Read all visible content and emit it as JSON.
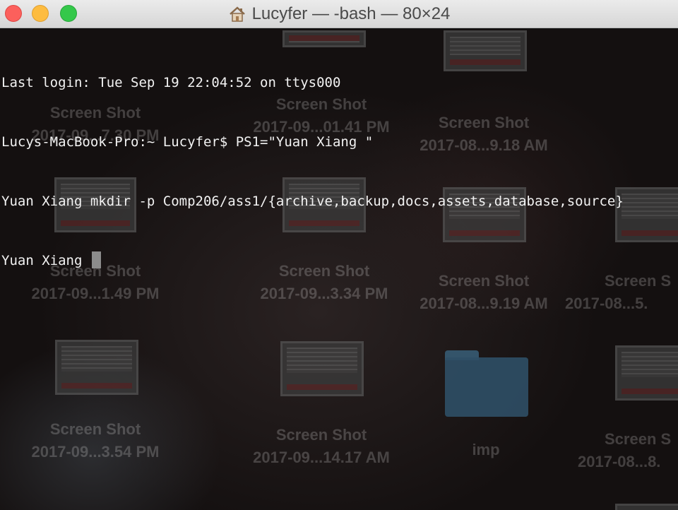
{
  "window": {
    "title": "Lucyfer — -bash — 80×24",
    "title_icon": "home-folder-icon"
  },
  "terminal": {
    "lines": [
      "Last login: Tue Sep 19 22:04:52 on ttys000",
      "Lucys-MacBook-Pro:~ Lucyfer$ PS1=\"Yuan Xiang \"",
      "Yuan Xiang mkdir -p Comp206/ass1/{archive,backup,docs,assets,database,source}",
      "Yuan Xiang "
    ]
  },
  "desktop": {
    "icons": [
      {
        "name": "Screen Shot",
        "date": "2017-09...7.30 PM"
      },
      {
        "name": "Screen Shot",
        "date": "2017-09...01.41 PM"
      },
      {
        "name": "Screen Shot",
        "date": "2017-08...9.18 AM"
      },
      {
        "name": "Screen Shot",
        "date": "2017-09...1.49 PM"
      },
      {
        "name": "Screen Shot",
        "date": "2017-09...3.34 PM"
      },
      {
        "name": "Screen Shot",
        "date": "2017-08...9.19 AM"
      },
      {
        "name": "Screen S",
        "date": "2017-08...5."
      },
      {
        "name": "Screen Shot",
        "date": "2017-09...3.54 PM"
      },
      {
        "name": "Screen Shot",
        "date": "2017-09...14.17 AM"
      },
      {
        "name": "imp",
        "date": ""
      },
      {
        "name": "Screen S",
        "date": "2017-08...8."
      }
    ]
  },
  "colors": {
    "close": "#fc605c",
    "minimize": "#fdbc40",
    "maximize": "#34c84a",
    "terminal_text": "#f2f2f2"
  }
}
